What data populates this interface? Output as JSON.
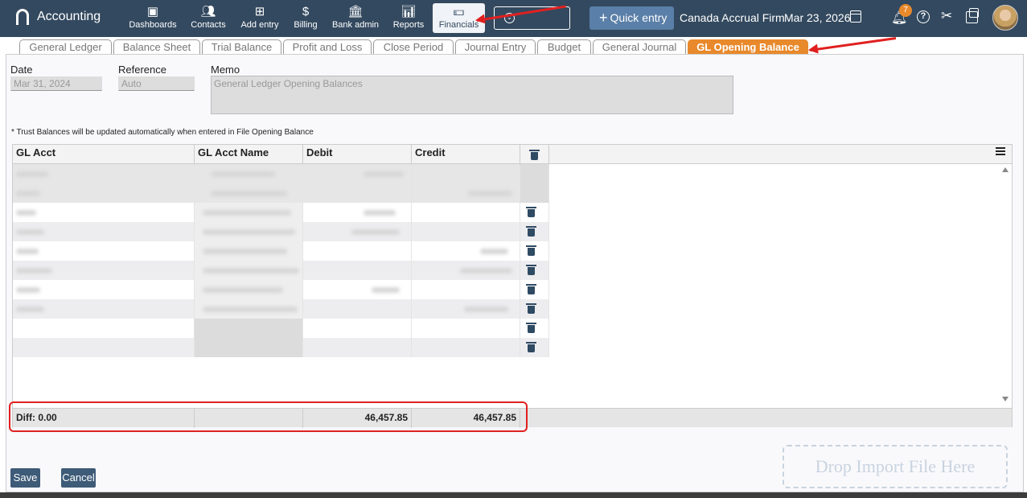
{
  "nav": {
    "app_name": "Accounting",
    "items": [
      {
        "label": "Dashboards",
        "icon": "dashboard-icon"
      },
      {
        "label": "Contacts",
        "icon": "contacts-icon"
      },
      {
        "label": "Add entry",
        "icon": "add-entry-icon"
      },
      {
        "label": "Billing",
        "icon": "billing-icon"
      },
      {
        "label": "Bank admin",
        "icon": "bank-icon"
      },
      {
        "label": "Reports",
        "icon": "reports-icon"
      },
      {
        "label": "Financials",
        "icon": "financials-icon"
      }
    ],
    "quick_entry_label": "Quick entry",
    "firm_name": "Canada Accrual Firm",
    "date": "Mar 23, 2026",
    "notification_count": "7",
    "help_glyph": "?"
  },
  "tabs": [
    {
      "label": "General Ledger"
    },
    {
      "label": "Balance Sheet"
    },
    {
      "label": "Trial Balance"
    },
    {
      "label": "Profit and Loss"
    },
    {
      "label": "Close Period"
    },
    {
      "label": "Journal Entry"
    },
    {
      "label": "Budget"
    },
    {
      "label": "General Journal"
    },
    {
      "label": "GL Opening Balance"
    }
  ],
  "form": {
    "date_label": "Date",
    "date_value": "Mar 31, 2024",
    "reference_label": "Reference",
    "reference_value": "Auto",
    "memo_label": "Memo",
    "memo_value": "General Ledger Opening Balances",
    "note": "* Trust Balances will be updated automatically when entered in File Opening Balance"
  },
  "grid": {
    "headers": [
      "GL Acct",
      "GL Acct Name",
      "Debit",
      "Credit"
    ],
    "footer": {
      "diff": "Diff: 0.00",
      "debit_total": "46,457.85",
      "credit_total": "46,457.85"
    }
  },
  "buttons": {
    "save": "Save",
    "cancel": "Cancel"
  },
  "drop_zone": "Drop Import File Here",
  "colors": {
    "nav": "#33495f",
    "active_tab": "#e8892b",
    "button": "#3e5b78",
    "annotation": "#e02020"
  }
}
